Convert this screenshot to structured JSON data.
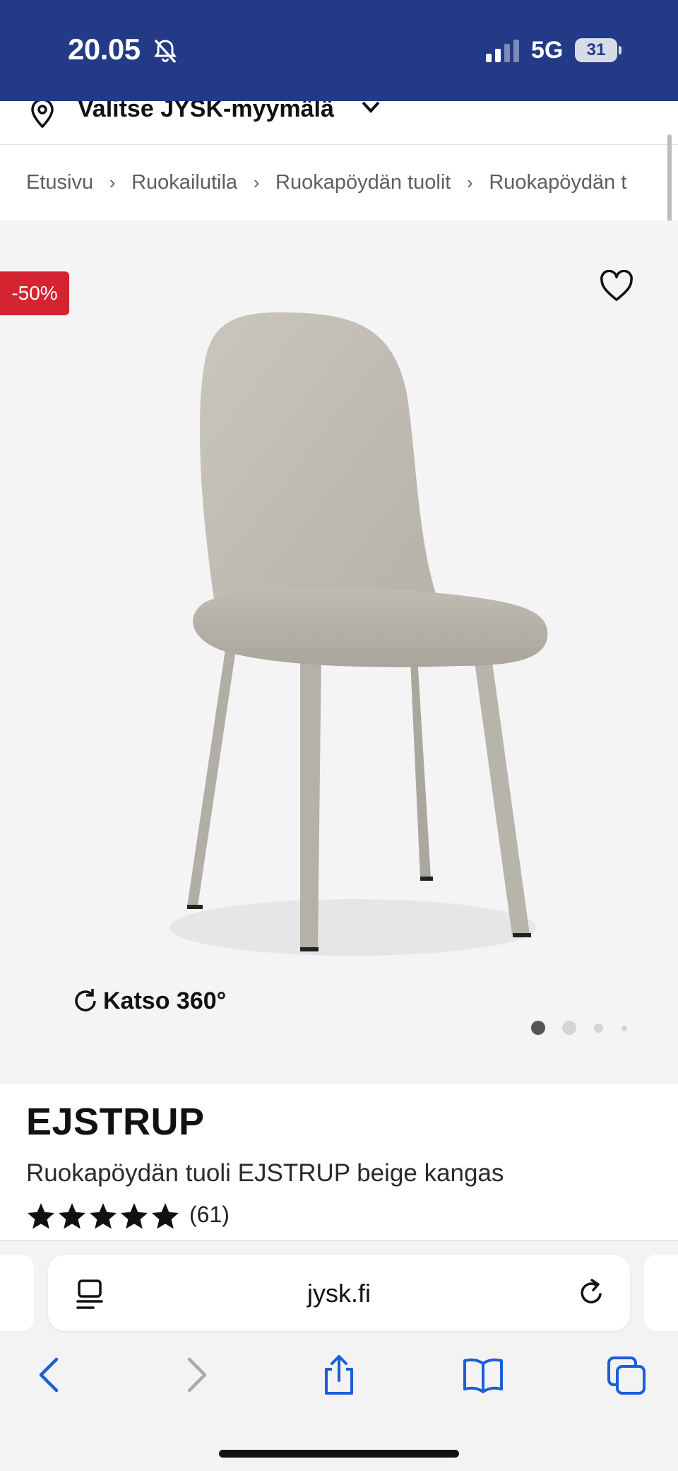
{
  "status_bar": {
    "time": "20.05",
    "network": "5G",
    "battery": "31",
    "background": "#233a86"
  },
  "store_selector": {
    "label": "Valitse JYSK-myymälä",
    "icon": "location-pin-icon"
  },
  "breadcrumb": [
    "Etusivu",
    "Ruokailutila",
    "Ruokapöydän tuolit",
    "Ruokapöydän t"
  ],
  "gallery": {
    "discount_badge": "-50%",
    "discount_color": "#d3242f",
    "view_360_label": "Katso 360°",
    "image_count": 4,
    "active_index": 0
  },
  "product": {
    "title": "EJSTRUP",
    "subtitle": "Ruokapöydän tuoli EJSTRUP beige kangas",
    "rating_stars": 5,
    "review_count": "(61)"
  },
  "browser": {
    "url": "jysk.fi",
    "buttons": [
      "back-icon",
      "forward-icon",
      "share-icon",
      "bookmarks-icon",
      "tabs-icon"
    ],
    "accent": "#1a5fd6"
  }
}
